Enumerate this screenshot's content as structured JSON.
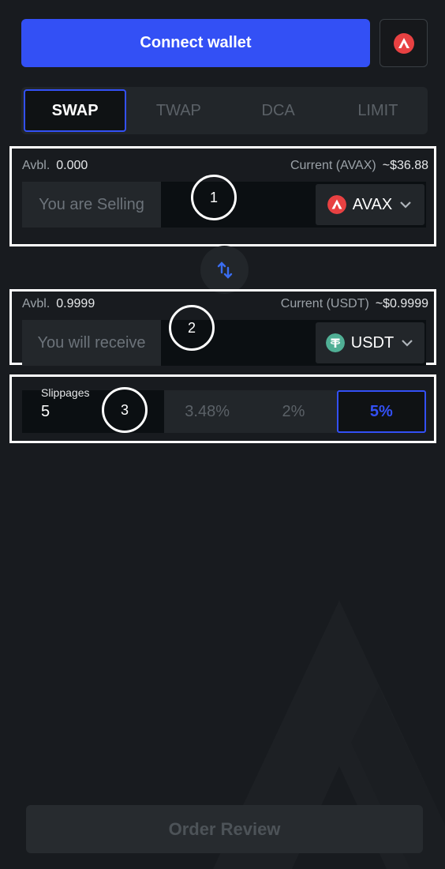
{
  "header": {
    "connect_label": "Connect wallet",
    "network_icon": "avalanche-icon"
  },
  "tabs": [
    {
      "label": "SWAP",
      "active": true
    },
    {
      "label": "TWAP",
      "active": false
    },
    {
      "label": "DCA",
      "active": false
    },
    {
      "label": "LIMIT",
      "active": false
    }
  ],
  "sell": {
    "avbl_label": "Avbl.",
    "avbl_value": "0.000",
    "current_label": "Current (AVAX)",
    "current_value": "~$36.88",
    "placeholder": "You are Selling",
    "token": "AVAX",
    "token_icon": "avalanche-icon",
    "token_color": "#e84142"
  },
  "swap_icon": "swap-arrows-icon",
  "receive": {
    "avbl_label": "Avbl.",
    "avbl_value": "0.9999",
    "current_label": "Current (USDT)",
    "current_value": "~$0.9999",
    "placeholder": "You will receive",
    "token": "USDT",
    "token_icon": "tether-icon",
    "token_color": "#50af95"
  },
  "slippage": {
    "label": "Slippages",
    "value": "5",
    "options": [
      "3.48%",
      "2%",
      "5%"
    ],
    "selected": "5%"
  },
  "markers": [
    "1",
    "2",
    "3"
  ],
  "footer": {
    "order_label": "Order Review"
  },
  "colors": {
    "accent": "#3350f5",
    "background": "#181b1f"
  }
}
